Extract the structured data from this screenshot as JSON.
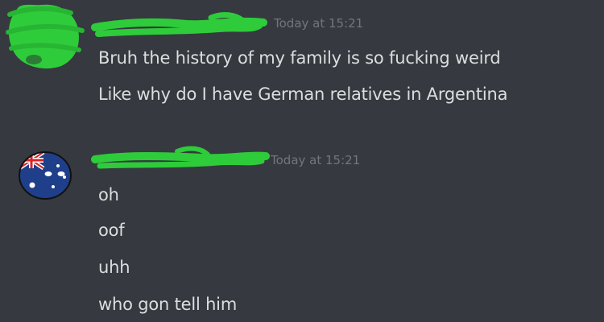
{
  "colors": {
    "background": "#36393f",
    "text": "#dcddde",
    "timestamp": "#72767d",
    "redaction": "#2ecc3a",
    "avatar_ball": "#1f3f8a"
  },
  "messages": [
    {
      "author_redacted": true,
      "avatar_icon": "green-scribble-avatar",
      "timestamp": "Today at 15:21",
      "lines": [
        "Bruh the history of my family is so fucking weird",
        "Like why do I have German relatives in Argentina"
      ]
    },
    {
      "author_redacted": true,
      "avatar_icon": "australia-countryball-avatar",
      "timestamp": "Today at 15:21",
      "lines": [
        "oh",
        "oof",
        "uhh",
        "who gon tell him"
      ]
    }
  ]
}
